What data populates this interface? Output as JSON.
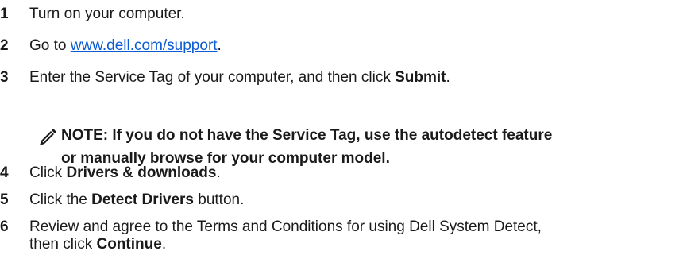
{
  "steps": [
    {
      "num": "1",
      "text": "Turn on your computer."
    },
    {
      "num": "2",
      "pre": "Go to ",
      "link": "www.dell.com/support",
      "post": "."
    },
    {
      "num": "3",
      "pre": "Enter the Service Tag of your computer, and then click ",
      "bold": "Submit",
      "post": "."
    },
    {
      "num": "4",
      "pre": "Click ",
      "bold": "Drivers & downloads",
      "post": "."
    },
    {
      "num": "5",
      "pre": "Click the ",
      "bold": "Detect Drivers",
      "post": " button."
    },
    {
      "num": "6",
      "line1": "Review and agree to the Terms and Conditions for using Dell System Detect,",
      "pre2": "then click ",
      "bold": "Continue",
      "post": "."
    }
  ],
  "note": {
    "icon": "pencil-note-icon",
    "line1": "NOTE: If you do not have the Service Tag, use the autodetect feature",
    "line2": "or manually browse for your computer model."
  },
  "colors": {
    "link": "#0b5bd3",
    "text": "#1a1a1a"
  }
}
